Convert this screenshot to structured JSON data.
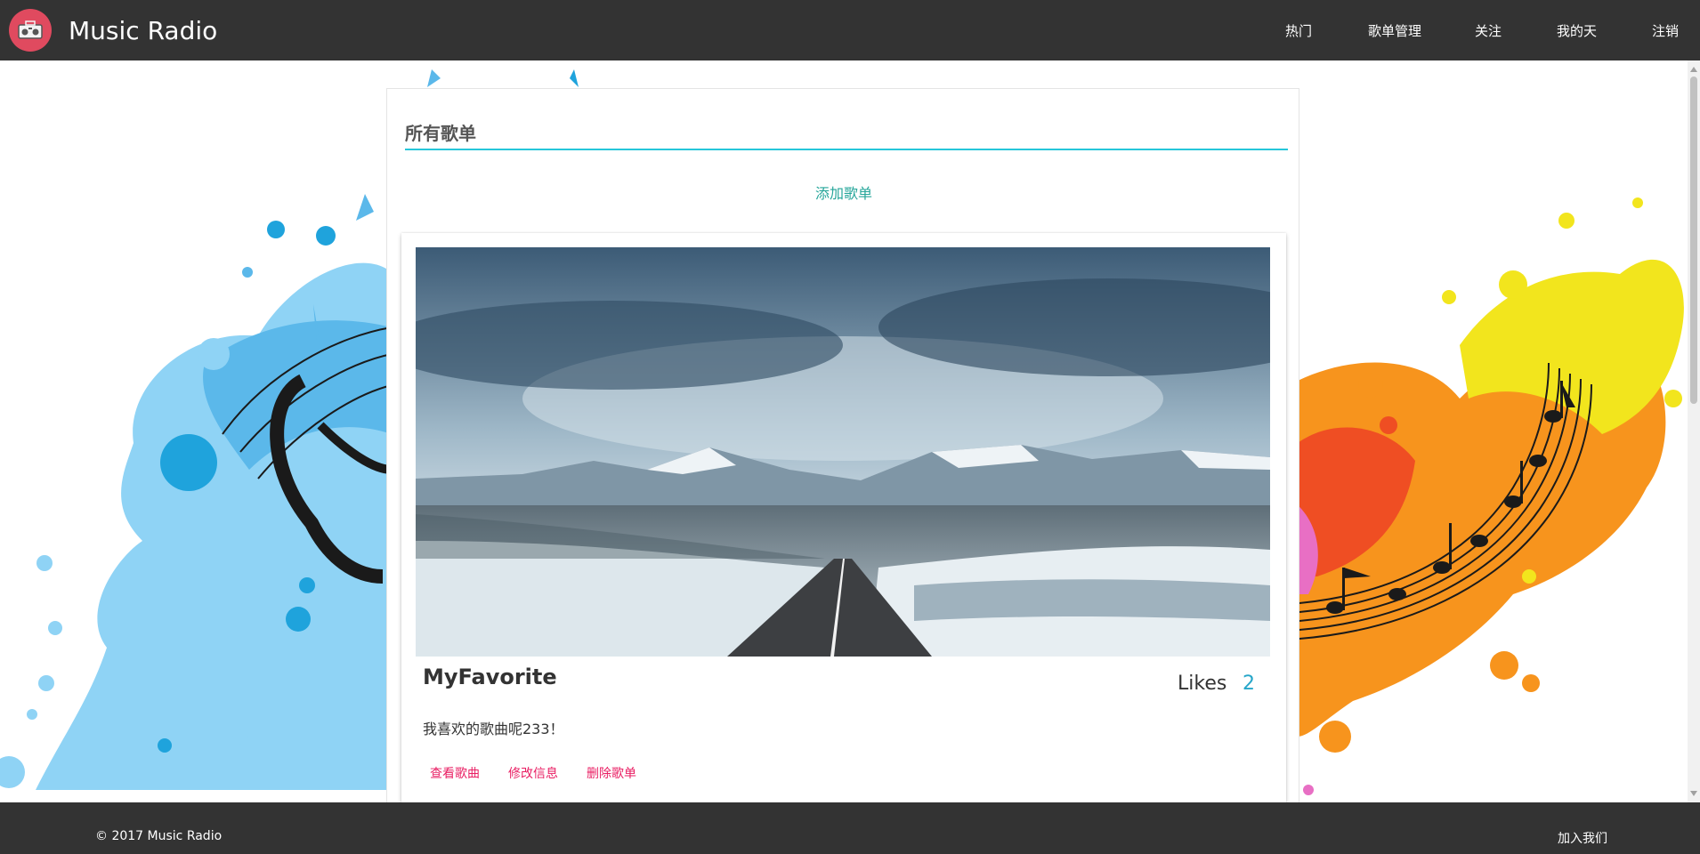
{
  "app": {
    "title": "Music Radio"
  },
  "nav": {
    "items": [
      {
        "label": "热门"
      },
      {
        "label": "歌单管理"
      },
      {
        "label": "关注"
      },
      {
        "label": "我的天"
      },
      {
        "label": "注销"
      }
    ]
  },
  "main": {
    "section_title": "所有歌单",
    "add_playlist_label": "添加歌单",
    "playlist": {
      "name": "MyFavorite",
      "likes_label": "Likes",
      "likes_count": "2",
      "description": "我喜欢的歌曲呢233！",
      "actions": [
        {
          "label": "查看歌曲"
        },
        {
          "label": "修改信息"
        },
        {
          "label": "删除歌单"
        }
      ]
    }
  },
  "footer": {
    "copyright": "© 2017 Music Radio",
    "join_label": "加入我们"
  },
  "colors": {
    "navbar": "#333333",
    "accent_teal": "#26c6da",
    "action_pink": "#e91e63",
    "logo_red": "#e04a5f"
  },
  "icons": {
    "logo": "radio-icon"
  }
}
